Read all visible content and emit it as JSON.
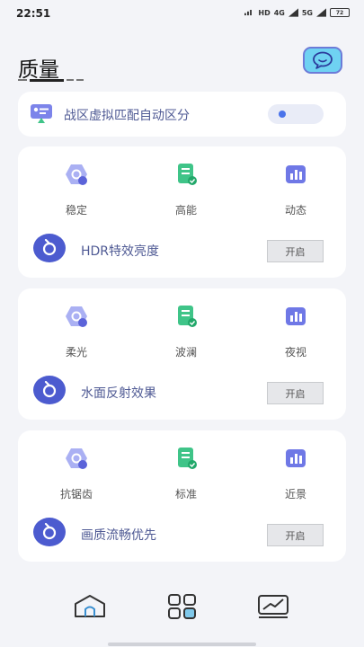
{
  "status_bar": {
    "time": "22:51",
    "network_1": "4G",
    "network_2": "5G",
    "battery": "72",
    "hd": "HD"
  },
  "header": {
    "title": "质量"
  },
  "top_card": {
    "label": "战区虚拟匹配自动区分",
    "toggle_on": false
  },
  "cards": [
    {
      "modes": [
        {
          "label": "稳定",
          "icon": "hexagon-icon"
        },
        {
          "label": "高能",
          "icon": "document-check-icon"
        },
        {
          "label": "动态",
          "icon": "bar-chart-icon"
        }
      ],
      "feature_label": "HDR特效亮度",
      "button_label": "开启"
    },
    {
      "modes": [
        {
          "label": "柔光",
          "icon": "hexagon-icon"
        },
        {
          "label": "波澜",
          "icon": "document-check-icon"
        },
        {
          "label": "夜视",
          "icon": "bar-chart-icon"
        }
      ],
      "feature_label": "水面反射效果",
      "button_label": "开启"
    },
    {
      "modes": [
        {
          "label": "抗锯齿",
          "icon": "hexagon-icon"
        },
        {
          "label": "标准",
          "icon": "document-check-icon"
        },
        {
          "label": "近景",
          "icon": "bar-chart-icon"
        }
      ],
      "feature_label": "画质流畅优先",
      "button_label": "开启"
    }
  ],
  "bottom_nav": [
    {
      "icon": "home-icon"
    },
    {
      "icon": "grid-icon"
    },
    {
      "icon": "trend-chart-icon"
    }
  ],
  "colors": {
    "accent": "#4c5bcf",
    "text_accent": "#4f5a94",
    "background": "#f3f4f8",
    "green": "#3fc488",
    "purple": "#6f78e6"
  }
}
